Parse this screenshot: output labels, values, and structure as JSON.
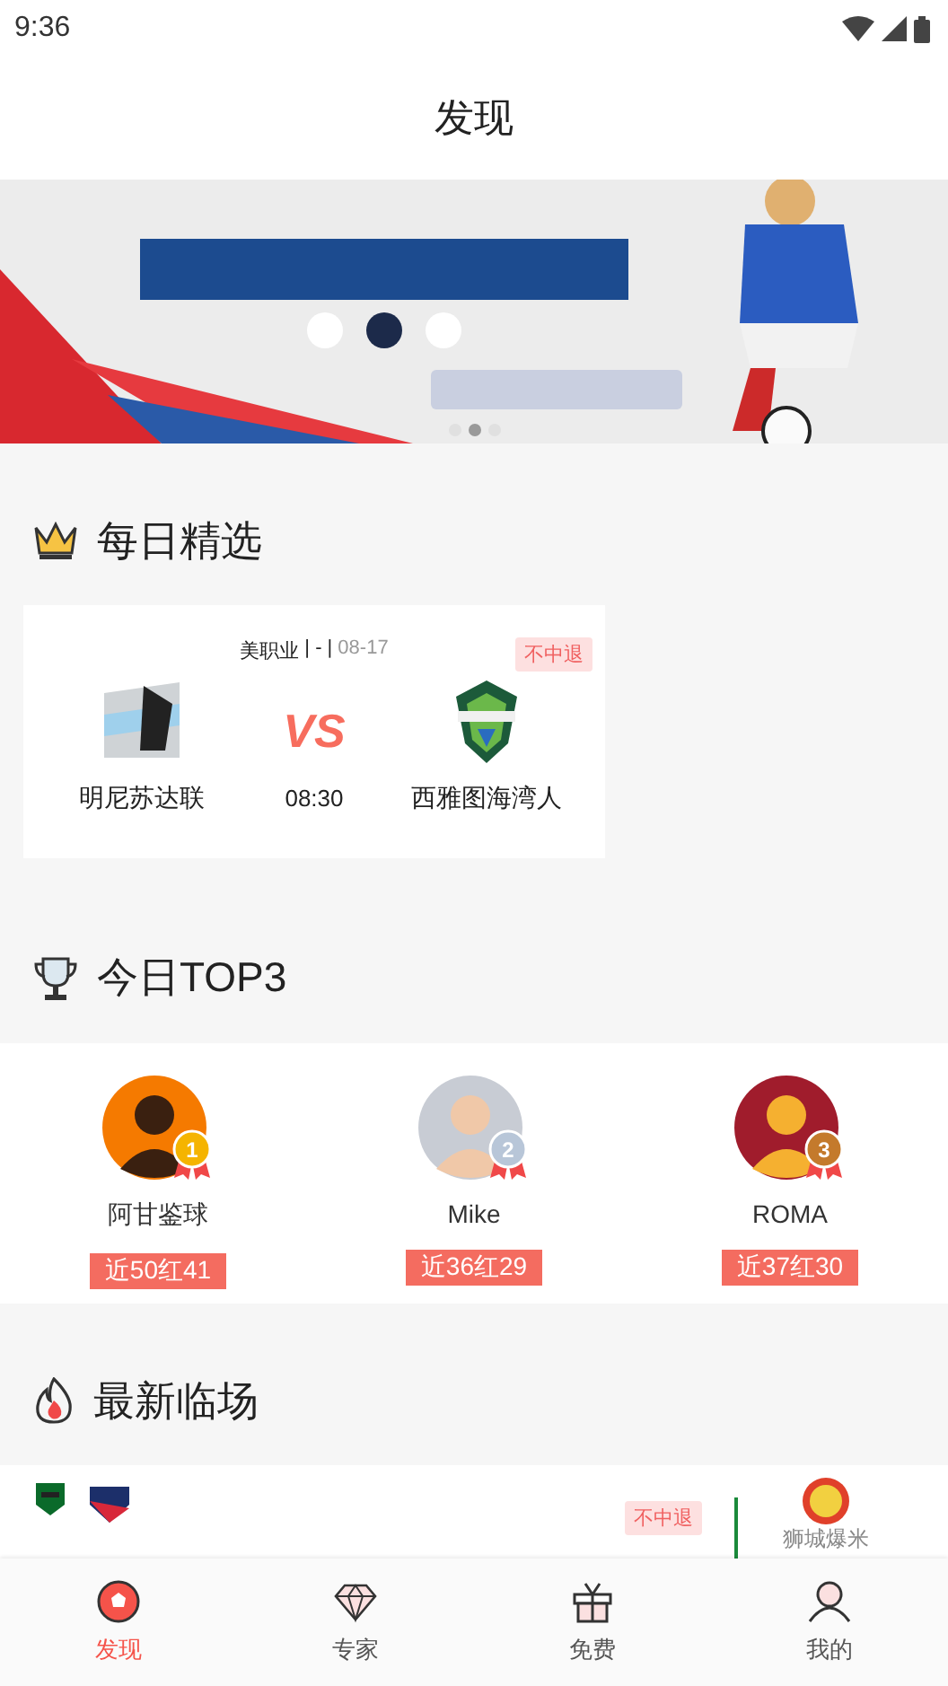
{
  "status_bar": {
    "time": "9:36"
  },
  "header": {
    "title": "发现"
  },
  "banner": {
    "kind": "picture",
    "dots": [
      {
        "selected": false
      },
      {
        "selected": true
      },
      {
        "selected": false
      }
    ]
  },
  "daily": {
    "title": "每日精选",
    "matches": [
      {
        "league": "美职业",
        "separator": "| - |",
        "date": "08-17",
        "tag": "不中退",
        "home": "明尼苏达联",
        "away": "西雅图海湾人",
        "vs": "VS",
        "time": "08:30"
      }
    ]
  },
  "top3": {
    "title": "今日TOP3",
    "experts": [
      {
        "name": "阿甘鉴球",
        "rank": "1",
        "color": "#f5b400",
        "record": "近50红41"
      },
      {
        "name": "Mike",
        "rank": "2",
        "color": "#b8c6d8",
        "record": "近36红29"
      },
      {
        "name": "ROMA",
        "rank": "3",
        "color": "#c47a2c",
        "record": "近37红30"
      }
    ]
  },
  "latest": {
    "title": "最新临场",
    "cards": [
      {
        "tag": "不中退",
        "expert": "狮城爆米"
      }
    ]
  },
  "tab_bar": {
    "items": [
      {
        "label": "发现",
        "kind": "ball",
        "selected": true
      },
      {
        "label": "专家",
        "kind": "diamond",
        "selected": false
      },
      {
        "label": "免费",
        "kind": "gift",
        "selected": false
      },
      {
        "label": "我的",
        "kind": "person",
        "selected": false
      }
    ]
  }
}
